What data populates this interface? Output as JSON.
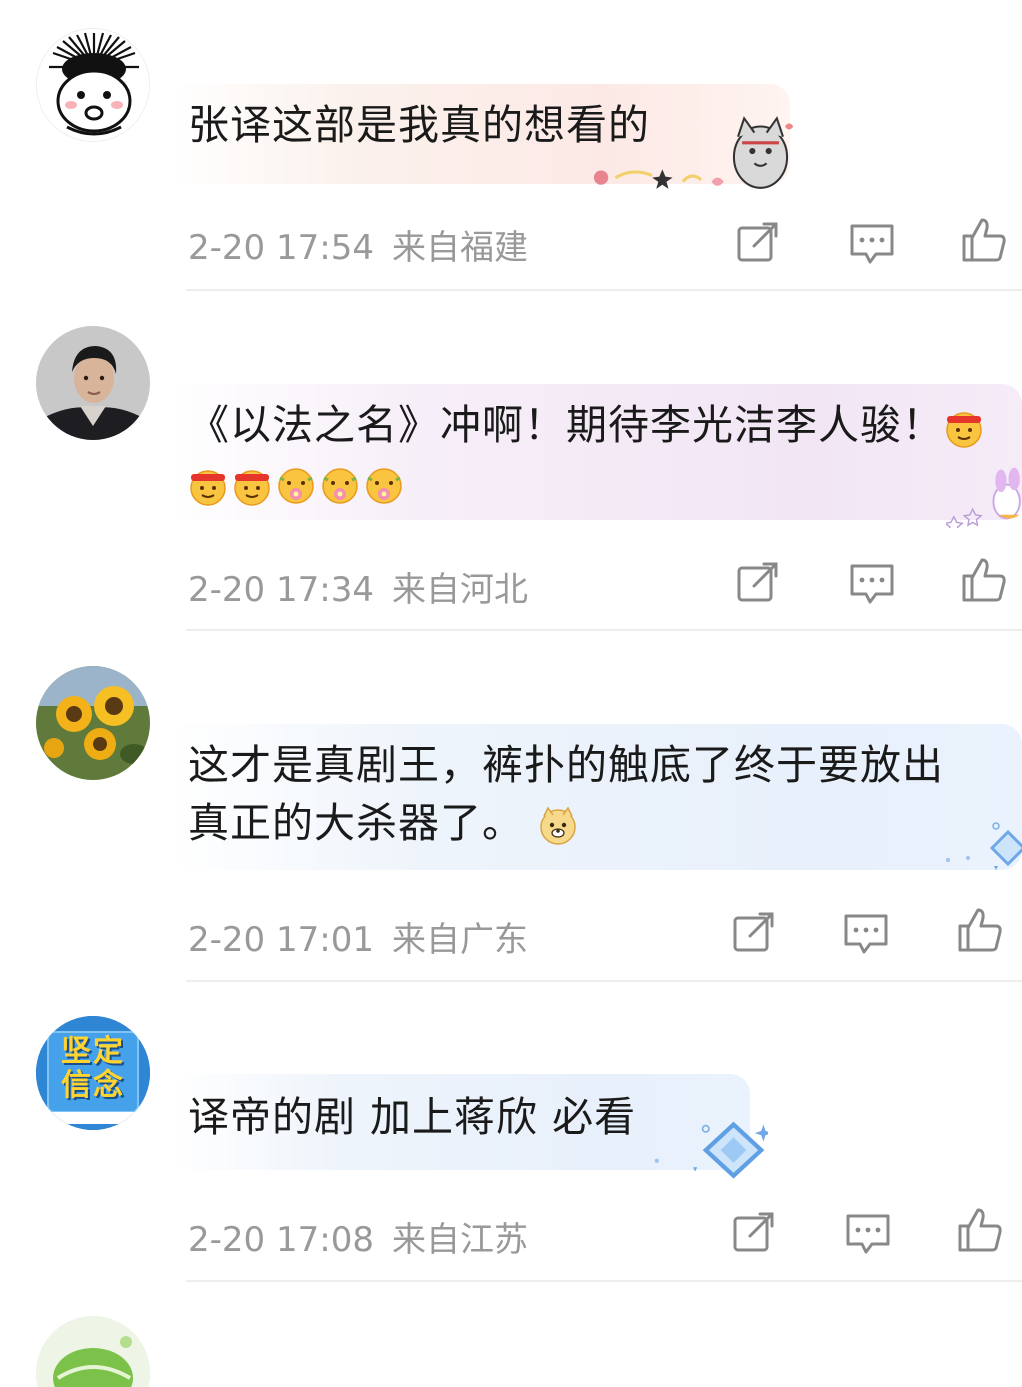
{
  "comments": [
    {
      "text": "张译这部是我真的想看的",
      "time": "2-20 17:54",
      "location": "来自福建",
      "avatar_icon": "cartoon-messy-hair-face",
      "bubble_style": "pink"
    },
    {
      "text_line1": "《以法之名》冲啊！期待李光洁李人骏！",
      "time": "2-20 17:34",
      "location": "来自河北",
      "avatar_icon": "man-portrait",
      "bubble_style": "lilac",
      "emoji_names": [
        "fighting-face-emoji",
        "fighting-face-emoji",
        "fighting-face-emoji",
        "flower-face-emoji",
        "flower-face-emoji",
        "flower-face-emoji"
      ]
    },
    {
      "text_line1": "这才是真剧王，裤扑的触底了终于要放出",
      "text_line2": "真正的大杀器了。",
      "time": "2-20 17:01",
      "location": "来自广东",
      "avatar_icon": "sunflowers-photo",
      "bubble_style": "blue",
      "emoji_names": [
        "doge-emoji"
      ]
    },
    {
      "text": "译帝的剧 加上蒋欣 必看",
      "time": "2-20 17:08",
      "location": "来自江苏",
      "avatar_icon": "blue-badge-logo",
      "avatar_text": "坚定信念",
      "bubble_style": "blue"
    }
  ],
  "actions": {
    "share_icon": "share-icon",
    "comment_icon": "comment-icon",
    "like_icon": "like-icon"
  },
  "colors": {
    "meta_text": "#999999",
    "body_text": "#1a1a1a",
    "divider": "#eeeeee",
    "icon": "#888888"
  }
}
